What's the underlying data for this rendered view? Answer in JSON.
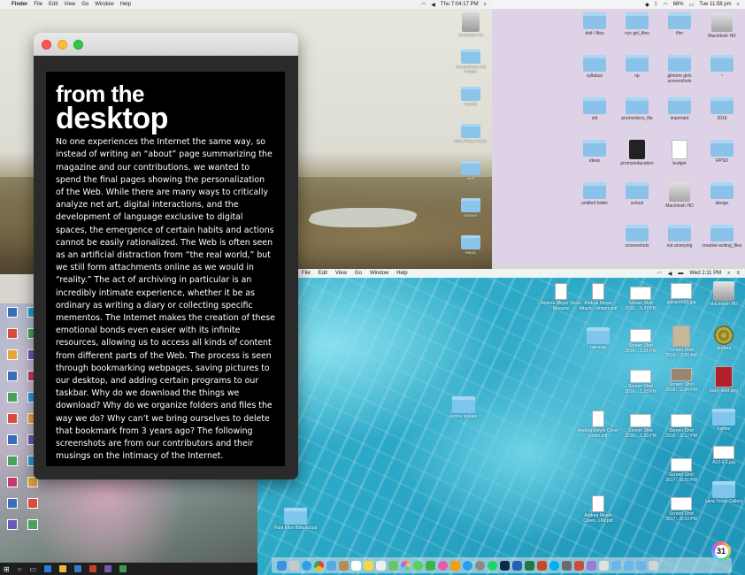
{
  "photo_desktop": {
    "menubar": {
      "app": "Finder",
      "items": [
        "File",
        "Edit",
        "View",
        "Go",
        "Window",
        "Help"
      ],
      "clock": "Thu 7:04:17 PM"
    },
    "icons": [
      "Macintosh HD",
      "Screenshots and images",
      "travels",
      "Misc Photo Folder",
      "web",
      "Movies",
      "Music"
    ]
  },
  "lavender_desktop": {
    "menubar": {
      "battery": "68%",
      "clock": "Tue 11:58 pm"
    },
    "icons": [
      "dolt / files",
      "nyc girl_files",
      "film",
      "Macintosh HD",
      "syllabus",
      "np",
      "gilmore girls screenshots",
      "~",
      "old",
      "promo/docs_file",
      "important",
      "2016",
      "ideas",
      "promo/education",
      "budget",
      "RPSD",
      "untitled folder",
      "school",
      "Macintosh HD",
      "design",
      "",
      "screenshots",
      "not annoying",
      "creative writing_files"
    ]
  },
  "water_desktop": {
    "menubar": {
      "items": [
        "File",
        "Edit",
        "View",
        "Go",
        "Window",
        "Help"
      ],
      "clock": "Wed 2:11 PM"
    },
    "icons": {
      "resume": "Andrea Meyer Stock Resume",
      "attach": "Andrea Meyer Attach...uments.pdf",
      "shot1": "Screen Shot 2016-...5.47 PM",
      "passport": "passport21.jpg",
      "hd": "Macintosh HD",
      "barnegs": "barnegs",
      "shot2": "Screen Shot 2016-...1.21 PM",
      "shot3": "Screen Shot 2016-...3.00 AM",
      "andrea": "Andrea",
      "shot4": "Screen Shot 2016-...1.23 PM",
      "shot5": "Screen Shot 2016-...2.54 PM",
      "lucky": "lucky-shot.png",
      "visuals": "article visuals",
      "cover": "Andrea Meyer Cover Letter.pdf",
      "shot6": "Screen Shot 2016-...1.33 PM",
      "shot7": "Screen Shot 2016-...5.12 PM",
      "invites": "Invites",
      "a10": "A10-2-1.jpg",
      "shot8": "Screen Shot 2017-...0.51 PM",
      "gallery": "Lana Tosca Gallery",
      "fotos": "Para fotos libro actual",
      "cover2": "Andrea Meyer Cover...UW.pdf",
      "shot9": "Screen Shot 2017-...8.03 PM"
    },
    "calendar_badge": "31"
  },
  "article": {
    "title_line1": "from the",
    "title_line2": "desktop",
    "body": "No one experiences the Internet the same way, so instead of writing an “about” page summarizing the magazine and our contributions, we wanted to spend the final pages showing the personalization of the Web. While there are many ways to critically analyze net art, digital interactions, and the development of language exclusive to digital spaces, the emergence of certain habits and actions cannot be easily rationalized. The Web is often seen as an artificial distraction from “the real world,” but we still form attachments online as we would in “reality.” The act of archiving in particular is an incredibly intimate experience, whether it be as ordinary as writing a diary or collecting specific mementos. The Internet makes the creation of these emotional bonds even easier with its infinite resources, allowing us to access all kinds of content from different parts of the Web. The process is seen through bookmarking webpages, saving pictures to our desktop, and adding certain programs to our taskbar. Why do we download the things we download? Why do we organize folders and files the way we do? Why can’t we bring ourselves to delete that bookmark from 3 years ago? The following screenshots are from our contributors and their musings on the intimacy of the Internet."
  }
}
